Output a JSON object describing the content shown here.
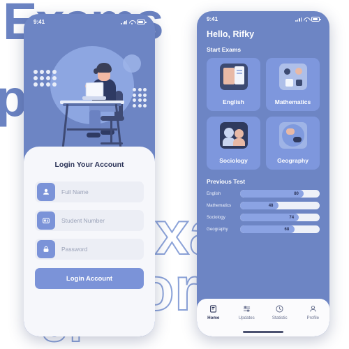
{
  "background": {
    "word_top": "Exams",
    "word_mid": "port",
    "word_outline_1": "xam",
    "word_outline_2": "ortfoli",
    "word_outline_3": "Ji"
  },
  "status_bar": {
    "time": "9:41",
    "signal_icon": "cellular-bars-icon",
    "wifi_icon": "wifi-icon",
    "battery_icon": "battery-icon"
  },
  "login_screen": {
    "illustration_name": "student-at-desk-illustration",
    "title": "Login Your Account",
    "fields": [
      {
        "icon": "user-icon",
        "placeholder": "Full Name",
        "value": ""
      },
      {
        "icon": "id-card-icon",
        "placeholder": "Student Number",
        "value": ""
      },
      {
        "icon": "lock-icon",
        "placeholder": "Password",
        "value": ""
      }
    ],
    "submit_label": "Login Account"
  },
  "home_screen": {
    "greeting": "Hello, Rifky",
    "start_exams_title": "Start Exams",
    "exams": [
      {
        "label": "English",
        "thumb": "english-book-thumb"
      },
      {
        "label": "Mathematics",
        "thumb": "mathematics-thumb"
      },
      {
        "label": "Sociology",
        "thumb": "sociology-thumb"
      },
      {
        "label": "Geography",
        "thumb": "geography-globe-thumb"
      }
    ],
    "previous_test_title": "Previous Test",
    "previous_tests": [
      {
        "name": "English",
        "score": "80",
        "percent": 80
      },
      {
        "name": "Mathematics",
        "score": "48",
        "percent": 48
      },
      {
        "name": "Sociology",
        "score": "74",
        "percent": 74
      },
      {
        "name": "Geography",
        "score": "68",
        "percent": 68
      }
    ],
    "tabs": [
      {
        "label": "Home",
        "icon": "home-icon",
        "active": true
      },
      {
        "label": "Updates",
        "icon": "updates-icon",
        "active": false
      },
      {
        "label": "Statistic",
        "icon": "statistic-icon",
        "active": false
      },
      {
        "label": "Profile",
        "icon": "profile-icon",
        "active": false
      }
    ]
  },
  "colors": {
    "phone_bg": "#6d85c4",
    "accent": "#7b93d8",
    "card": "#7e97dd",
    "light": "#f6f7fb",
    "text_dark": "#2b3357"
  }
}
